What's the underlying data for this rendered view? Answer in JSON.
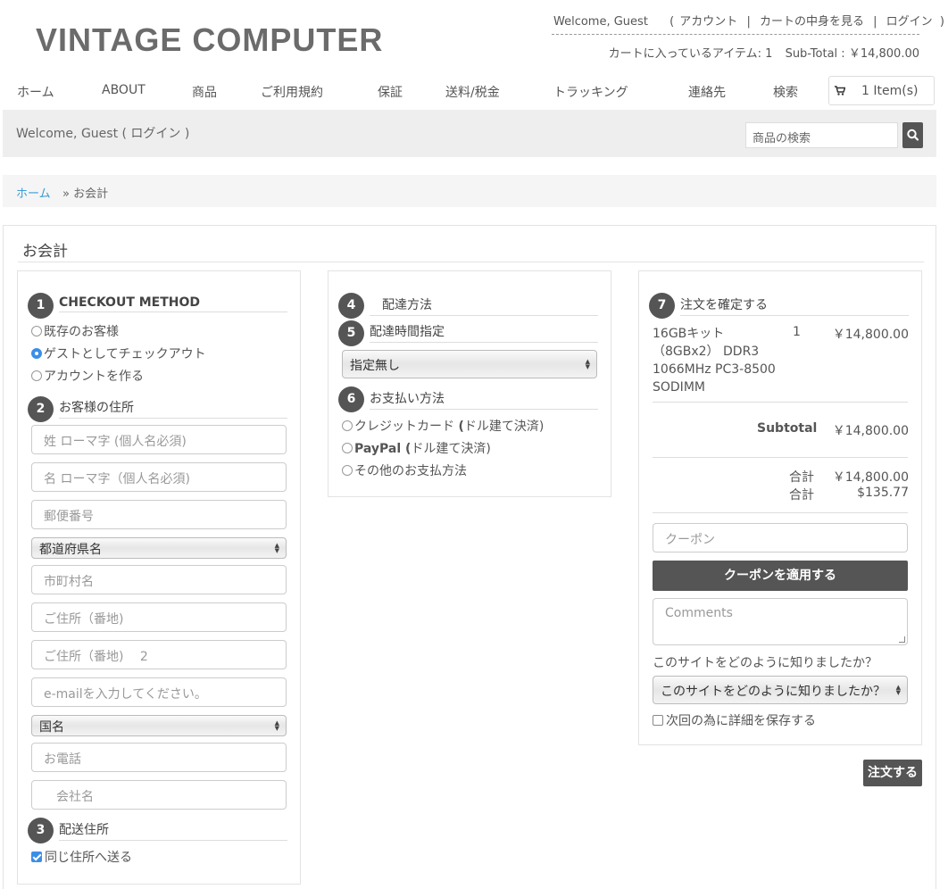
{
  "header": {
    "logo": "VINTAGE COMPUTER",
    "welcome": "Welcome, Guest",
    "links_open": "(",
    "account": "アカウント",
    "pipe": "|",
    "view_cart": "カートの中身を見る",
    "login": "ログイン",
    "links_close": ")",
    "cart_items_label": "カートに入っているアイテム:",
    "cart_items_count": "1",
    "subtotal_label": "Sub-Total :",
    "subtotal_value": "￥14,800.00"
  },
  "nav": {
    "items": [
      "ホーム",
      "ABOUT",
      "商品",
      "ご利用規約",
      "保証",
      "送料/税金",
      "トラッキング",
      "連絡先",
      "検索"
    ],
    "cart_label": "1 Item(s)"
  },
  "searchbar": {
    "welcome": "Welcome, Guest ( ログイン )",
    "placeholder": "商品の検索"
  },
  "breadcrumb": {
    "home": "ホーム",
    "current": "» お会計"
  },
  "page": {
    "title": "お会計"
  },
  "col1": {
    "s1": {
      "num": "1",
      "title": "CHECKOUT METHOD"
    },
    "methods": [
      "既存のお客様",
      "ゲストとしてチェックアウト",
      "アカウントを作る"
    ],
    "s2": {
      "num": "2",
      "title": "お客様の住所"
    },
    "fields": {
      "lastname": "姓 ローマ字 (個人名必須)",
      "firstname": "名 ローマ字（個人名必須)",
      "postal": "郵便番号",
      "prefecture": "都道府県名",
      "city": "市町村名",
      "address1": "ご住所（番地)",
      "address2": "ご住所（番地)　 2",
      "email": "e-mailを入力してください。",
      "country": "国名",
      "phone": "お電話",
      "company": "　会社名"
    },
    "s3": {
      "num": "3",
      "title": "配送住所"
    },
    "same_address": "同じ住所へ送る"
  },
  "col2": {
    "s4": {
      "num": "4",
      "title": "配達方法"
    },
    "s5": {
      "num": "5",
      "title": "配達時間指定"
    },
    "delivery_time": "指定無し",
    "s6": {
      "num": "6",
      "title": "お支払い方法"
    },
    "payments": {
      "credit_pre": "クレジットカード ",
      "credit_bold": "(",
      "credit_post": "ドル建て決済)",
      "paypal_bold": "PayPal (",
      "paypal_post": "ドル建て決済)",
      "other": "その他のお支払方法"
    }
  },
  "col3": {
    "s7": {
      "num": "7",
      "title": "注文を確定する"
    },
    "item": {
      "name": "16GBキット（8GBx2） DDR3 1066MHz PC3-8500 SODIMM",
      "qty": "1",
      "price": "￥14,800.00"
    },
    "subtotal_label": "Subtotal",
    "subtotal_value": "￥14,800.00",
    "total_label": "合計",
    "total_value": "￥14,800.00",
    "total2_label": "合計",
    "total2_value": "$135.77",
    "coupon_placeholder": "クーポン",
    "coupon_button": "クーポンを適用する",
    "comments_placeholder": "Comments",
    "source_question": "このサイトをどのように知りましたか？",
    "source_select": "このサイトをどのように知りましたか？",
    "save_details": "次回の為に詳細を保存する",
    "order_button": "注文する"
  }
}
